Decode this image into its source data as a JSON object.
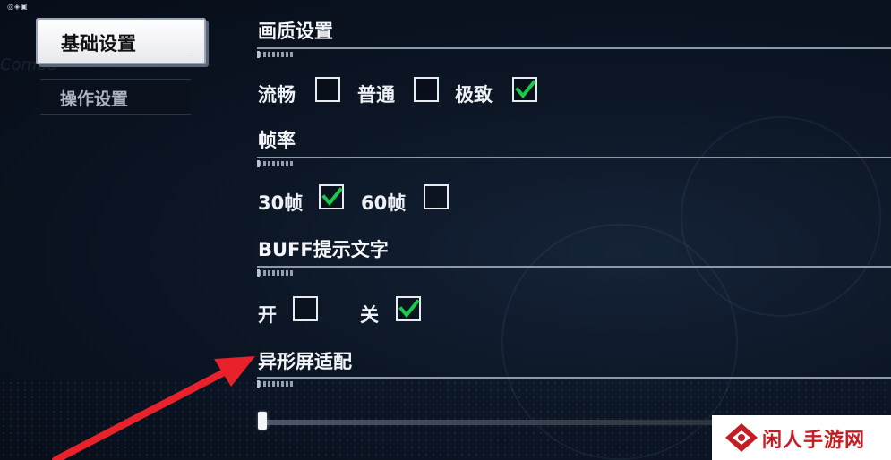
{
  "top_glyph": "◎◈▣",
  "background_text": "Combo",
  "sidebar": {
    "items": [
      {
        "label": "基础设置",
        "active": true,
        "mark": "---"
      },
      {
        "label": "操作设置",
        "active": false
      }
    ]
  },
  "sections": {
    "quality": {
      "title": "画质设置",
      "options": [
        {
          "label": "流畅",
          "checked": false
        },
        {
          "label": "普通",
          "checked": false
        },
        {
          "label": "极致",
          "checked": true
        }
      ]
    },
    "framerate": {
      "title": "帧率",
      "options": [
        {
          "label": "30帧",
          "checked": true
        },
        {
          "label": "60帧",
          "checked": false
        }
      ]
    },
    "buff_text": {
      "title": "BUFF提示文字",
      "options": [
        {
          "label": "开",
          "checked": false
        },
        {
          "label": "关",
          "checked": true
        }
      ]
    },
    "screen_adapt": {
      "title": "异形屏适配",
      "slider_value": 0
    }
  },
  "colors": {
    "check": "#19c94a",
    "arrow": "#e8212a",
    "watermark": "#c41e24"
  },
  "watermark": {
    "text": "闲人手游网",
    "icon": "diamond-logo-icon"
  }
}
